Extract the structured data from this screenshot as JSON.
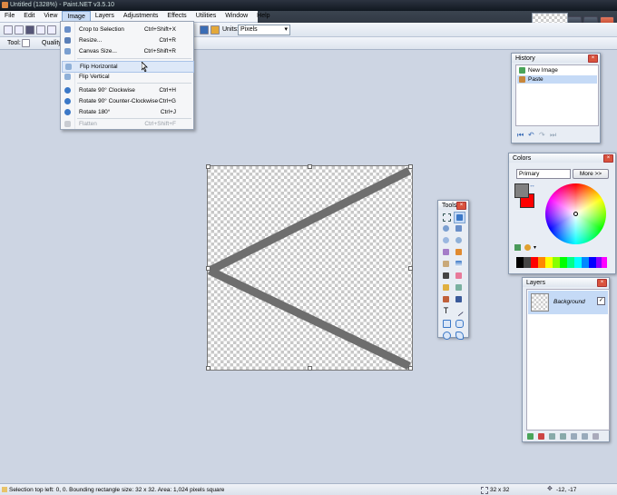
{
  "title": "Untitled (1328%) - Paint.NET v3.5.10",
  "menu": [
    "File",
    "Edit",
    "View",
    "Image",
    "Layers",
    "Adjustments",
    "Effects",
    "Utilities",
    "Window",
    "Help"
  ],
  "toolbar": {
    "units_label": "Units:",
    "units_value": "Pixels",
    "tool_label": "Tool:",
    "quality_label": "Quality"
  },
  "image_menu": [
    {
      "label": "Crop to Selection",
      "shortcut": "Ctrl+Shift+X",
      "enabled": true
    },
    {
      "label": "Resize...",
      "shortcut": "Ctrl+R",
      "enabled": true
    },
    {
      "label": "Canvas Size...",
      "shortcut": "Ctrl+Shift+R",
      "enabled": true
    },
    {
      "label": "Flip Horizontal",
      "shortcut": "",
      "enabled": true
    },
    {
      "label": "Flip Vertical",
      "shortcut": "",
      "enabled": true
    },
    {
      "label": "Rotate 90° Clockwise",
      "shortcut": "Ctrl+H",
      "enabled": true
    },
    {
      "label": "Rotate 90° Counter-Clockwise",
      "shortcut": "Ctrl+G",
      "enabled": true
    },
    {
      "label": "Rotate 180°",
      "shortcut": "Ctrl+J",
      "enabled": true
    },
    {
      "label": "Flatten",
      "shortcut": "Ctrl+Shift+F",
      "enabled": false
    }
  ],
  "history": {
    "title": "History",
    "items": [
      "New Image",
      "Paste"
    ]
  },
  "colors": {
    "title": "Colors",
    "mode": "Primary",
    "more_label": "More >>",
    "primary": "#808080",
    "secondary": "#ff0000"
  },
  "tools": {
    "title": "Tools"
  },
  "layers": {
    "title": "Layers",
    "items": [
      {
        "name": "Background",
        "visible": true
      }
    ]
  },
  "status": {
    "selection": "Selection top left: 0, 0. Bounding rectangle size: 32 x 32. Area: 1,024 pixels square",
    "size": "32 x 32",
    "position": "-12, -17"
  }
}
